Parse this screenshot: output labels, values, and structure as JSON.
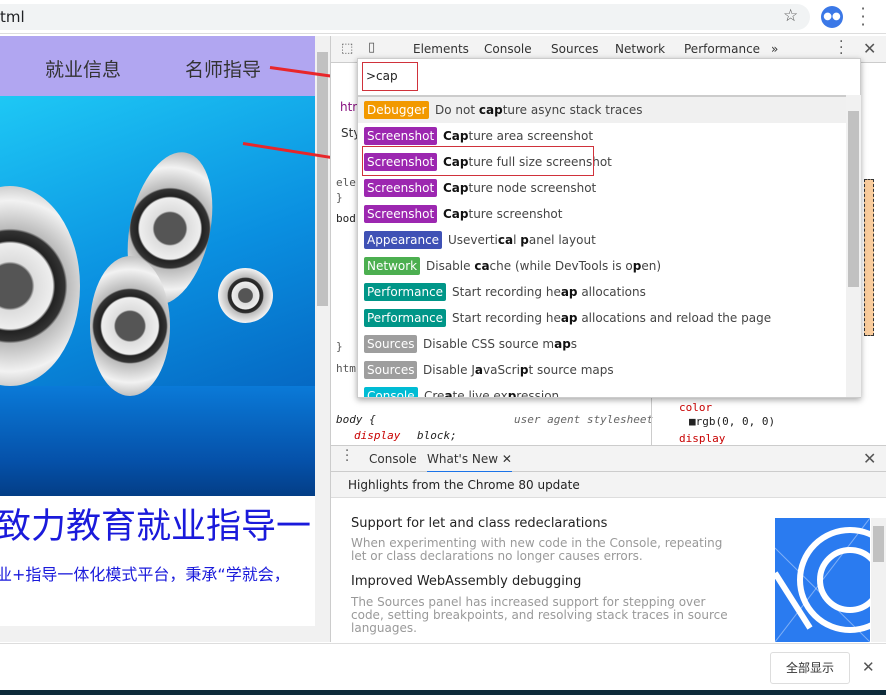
{
  "browser": {
    "url_fragment": "tml",
    "star_icon": "star-icon",
    "avatar_icon": "avatar-icon",
    "menu_icon": "kebab-menu-icon"
  },
  "page": {
    "nav": [
      "就业信息",
      "名师指导"
    ],
    "headline": "致力教育就业指导一",
    "subtitle": "业+指导一体化模式平台，秉承“学就会，"
  },
  "devtools": {
    "tabs": [
      "Elements",
      "Console",
      "Sources",
      "Network",
      "Performance"
    ],
    "more_tabs": "»",
    "behind": {
      "html": "htm",
      "styles_tab": "Sty",
      "ele": "ele",
      "brace": "}",
      "body": "bod",
      "html2": "htm",
      "brace2": "}",
      "ua_rule": "body {",
      "ua_label": "user agent stylesheet",
      "ua_prop": "display",
      "ua_value": "block;",
      "computed_prop1": "color",
      "computed_val1": "rgb(0, 0, 0)",
      "computed_prop2": "display"
    },
    "palette": {
      "input_value": ">cap",
      "items": [
        {
          "tag": "Debugger",
          "color": "#f29900",
          "parts": [
            {
              "t": "Do not "
            },
            {
              "t": "cap",
              "b": true
            },
            {
              "t": "ture async stack traces"
            }
          ]
        },
        {
          "tag": "Screenshot",
          "color": "#9c27b0",
          "parts": [
            {
              "t": "Cap",
              "b": true
            },
            {
              "t": "ture area screenshot"
            }
          ]
        },
        {
          "tag": "Screenshot",
          "color": "#9c27b0",
          "parts": [
            {
              "t": "Cap",
              "b": true
            },
            {
              "t": "ture full size screenshot"
            }
          ]
        },
        {
          "tag": "Screenshot",
          "color": "#9c27b0",
          "parts": [
            {
              "t": "Cap",
              "b": true
            },
            {
              "t": "ture node screenshot"
            }
          ]
        },
        {
          "tag": "Screenshot",
          "color": "#9c27b0",
          "parts": [
            {
              "t": "Cap",
              "b": true
            },
            {
              "t": "ture screenshot"
            }
          ]
        },
        {
          "tag": "Appearance",
          "color": "#3f51b5",
          "parts": [
            {
              "t": "Useverti"
            },
            {
              "t": "ca",
              "b": true
            },
            {
              "t": "l "
            },
            {
              "t": "p",
              "b": true
            },
            {
              "t": "anel layout"
            }
          ]
        },
        {
          "tag": "Network",
          "color": "#4caf50",
          "parts": [
            {
              "t": "Disable "
            },
            {
              "t": "ca",
              "b": true
            },
            {
              "t": "che (while DevTools is o"
            },
            {
              "t": "p",
              "b": true
            },
            {
              "t": "en)"
            }
          ]
        },
        {
          "tag": "Performance",
          "color": "#009688",
          "parts": [
            {
              "t": "Start recording he"
            },
            {
              "t": "ap",
              "b": true
            },
            {
              "t": " allocations"
            }
          ]
        },
        {
          "tag": "Performance",
          "color": "#009688",
          "parts": [
            {
              "t": "Start recording he"
            },
            {
              "t": "ap",
              "b": true
            },
            {
              "t": " allocations and reload the page"
            }
          ]
        },
        {
          "tag": "Sources",
          "color": "#9e9e9e",
          "parts": [
            {
              "t": "Disable CSS source m"
            },
            {
              "t": "ap",
              "b": true
            },
            {
              "t": "s"
            }
          ]
        },
        {
          "tag": "Sources",
          "color": "#9e9e9e",
          "parts": [
            {
              "t": "Disable J"
            },
            {
              "t": "a",
              "b": true
            },
            {
              "t": "vaScri"
            },
            {
              "t": "p",
              "b": true
            },
            {
              "t": "t source maps"
            }
          ]
        },
        {
          "tag": "Console",
          "color": "#00bcd4",
          "parts": [
            {
              "t": "Cre"
            },
            {
              "t": "a",
              "b": true
            },
            {
              "t": "te live ex"
            },
            {
              "t": "p",
              "b": true
            },
            {
              "t": "ression"
            }
          ]
        }
      ]
    },
    "drawer": {
      "tabs": [
        "Console",
        "What's New"
      ],
      "header": "Highlights from the Chrome 80 update",
      "entries": [
        {
          "title": "Support for let and class redeclarations",
          "desc": "When experimenting with new code in the Console, repeating let or class declarations no longer causes errors."
        },
        {
          "title": "Improved WebAssembly debugging",
          "desc": "The Sources panel has increased support for stepping over code, setting breakpoints, and resolving stack traces in source languages."
        }
      ]
    }
  },
  "download_bar": {
    "show_all": "全部显示"
  }
}
